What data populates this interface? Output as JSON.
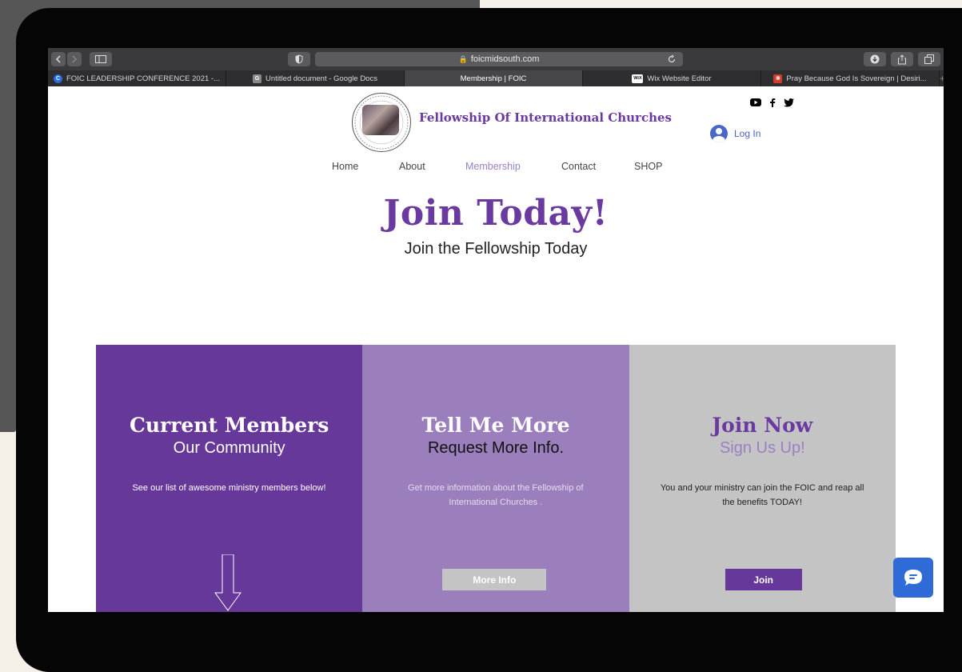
{
  "browser": {
    "url": "foicmidsouth.com",
    "tabs": [
      {
        "label": "FOIC LEADERSHIP CONFERENCE 2021 -...",
        "icon": "C",
        "icon_color": "#2a6fdb",
        "active": false
      },
      {
        "label": "Untitled document - Google Docs",
        "icon": "G",
        "icon_color": "#8a8a8a",
        "active": false
      },
      {
        "label": "Membership | FOIC",
        "icon": "",
        "icon_color": "",
        "active": true
      },
      {
        "label": "Wix Website Editor",
        "icon": "WiX",
        "icon_color": "#111111",
        "active": false
      },
      {
        "label": "Pray Because God Is Sovereign | Desiri...",
        "icon": "※",
        "icon_color": "#d23a2a",
        "active": false
      }
    ]
  },
  "header": {
    "site_title": "Fellowship Of International Churches",
    "login_label": "Log In",
    "social": [
      "youtube-icon",
      "facebook-icon",
      "twitter-icon"
    ]
  },
  "nav": {
    "items": [
      "Home",
      "About",
      "Membership",
      "Contact",
      "SHOP"
    ],
    "active": "Membership"
  },
  "hero": {
    "title": "Join Today!",
    "subtitle": "Join the Fellowship Today"
  },
  "columns": [
    {
      "title": "Current Members",
      "subtitle": "Our Community",
      "text": "See our list of awesome ministry members below!",
      "bg": "#66389a",
      "title_color": "#ffffff",
      "subtitle_color": "#ffffff",
      "text_color": "#ffffff"
    },
    {
      "title": "Tell Me More",
      "subtitle": "Request More Info.",
      "text": "Get more information about the Fellowship of International Churches .",
      "button": "More Info",
      "bg": "#9b7fbd",
      "title_color": "#ffffff",
      "subtitle_color": "#111111",
      "text_color": "#e4dbee"
    },
    {
      "title": "Join Now",
      "subtitle": "Sign Us Up!",
      "text": "You and your ministry can join the FOIC and reap all the benefits TODAY!",
      "button": "Join",
      "bg": "#c4c4c4",
      "title_color": "#6a3aa0",
      "subtitle_color": "#9b7fc6",
      "text_color": "#222222"
    }
  ],
  "colors": {
    "brand_purple": "#6a3aa0",
    "light_purple": "#9b7fbd",
    "chat_blue": "#2f6bd6",
    "login_blue": "#4a66c9"
  }
}
